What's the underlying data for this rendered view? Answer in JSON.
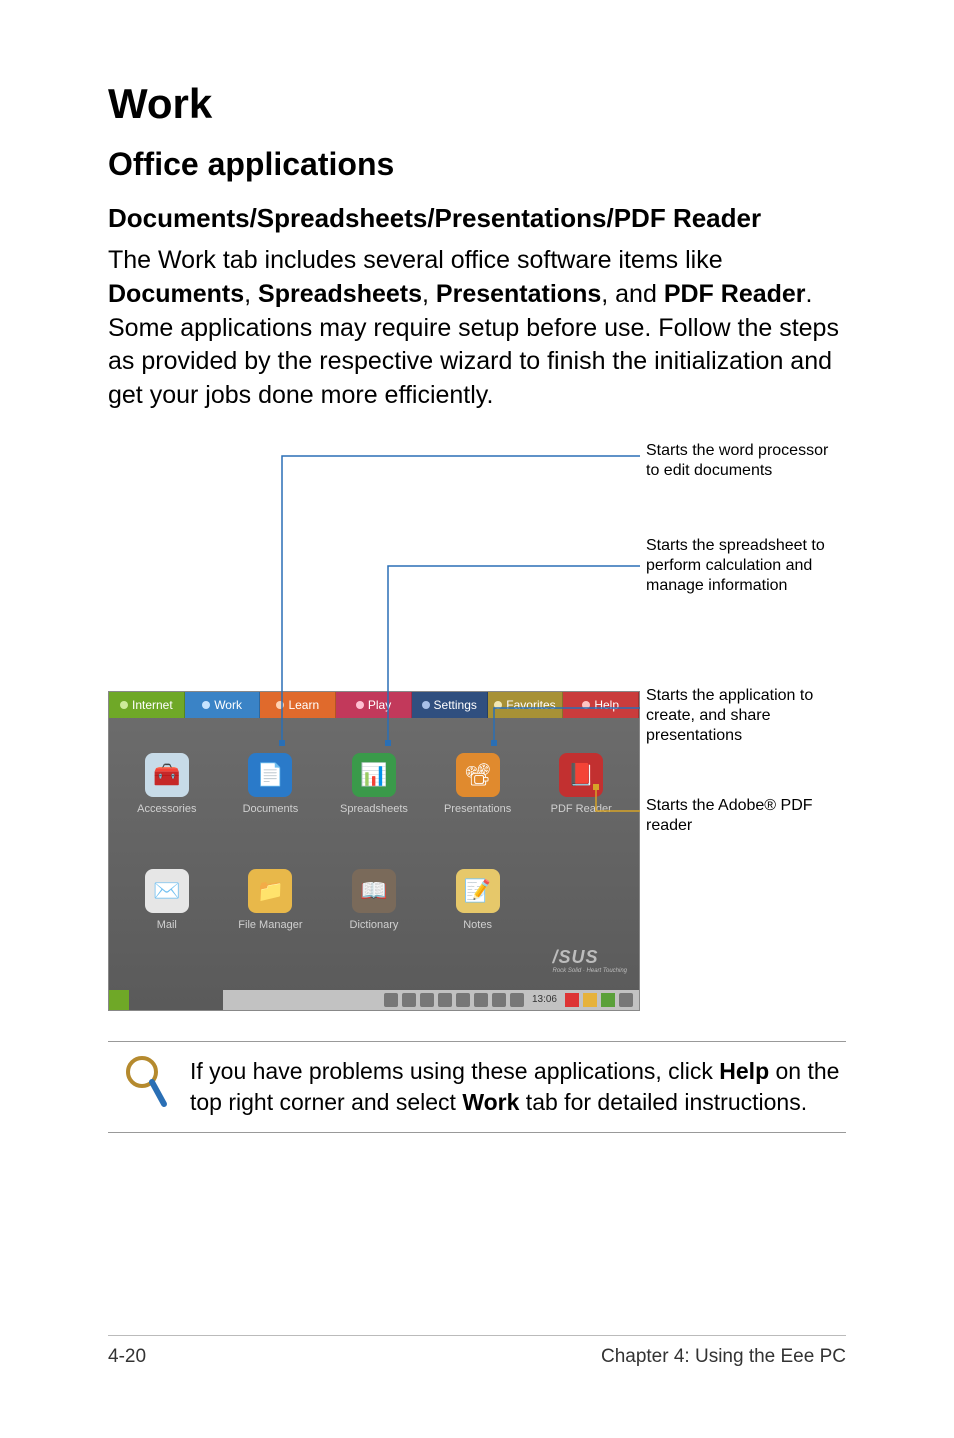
{
  "headings": {
    "h1": "Work",
    "h2": "Office applications",
    "h3": "Documents/Spreadsheets/Presentations/PDF Reader"
  },
  "para": {
    "p1_a": "The Work tab includes several office software items like ",
    "p1_b_docs": "Documents",
    "p1_c": ", ",
    "p1_d_spr": "Spreadsheets",
    "p1_e": ", ",
    "p1_f_pre": "Presentations",
    "p1_g": ", and ",
    "p1_h_pdf": "PDF Reader",
    "p1_i": ". Some applications may require setup before use. Follow the steps as provided by the respective wizard to finish the initialization and get your jobs done more efficiently."
  },
  "tabs": {
    "internet": "Internet",
    "work": "Work",
    "learn": "Learn",
    "play": "Play",
    "settings": "Settings",
    "favorites": "Favorites",
    "help": "Help"
  },
  "icons": {
    "accessories": "Accessories",
    "documents": "Documents",
    "spreadsheets": "Spreadsheets",
    "presentations": "Presentations",
    "pdf": "PDF Reader",
    "mail": "Mail",
    "filemgr": "File Manager",
    "dictionary": "Dictionary",
    "notes": "Notes"
  },
  "logo": {
    "brand": "/SUS",
    "tag": "Rock Solid · Heart Touching"
  },
  "taskbar": {
    "clock": "13:06"
  },
  "annotations": {
    "a1": "Starts the word processor to edit documents",
    "a2": "Starts the spreadsheet to perform calculation and manage information",
    "a3": "Starts the application to create, and share presentations",
    "a4": "Starts the Adobe® PDF reader"
  },
  "note": {
    "t1": "If you have problems using these applications, click ",
    "b1": "Help",
    "t2": " on the top right corner and select ",
    "b2": "Work",
    "t3": " tab for detailed instructions."
  },
  "footer": {
    "left": "4-20",
    "right": "Chapter 4: Using the Eee PC"
  }
}
